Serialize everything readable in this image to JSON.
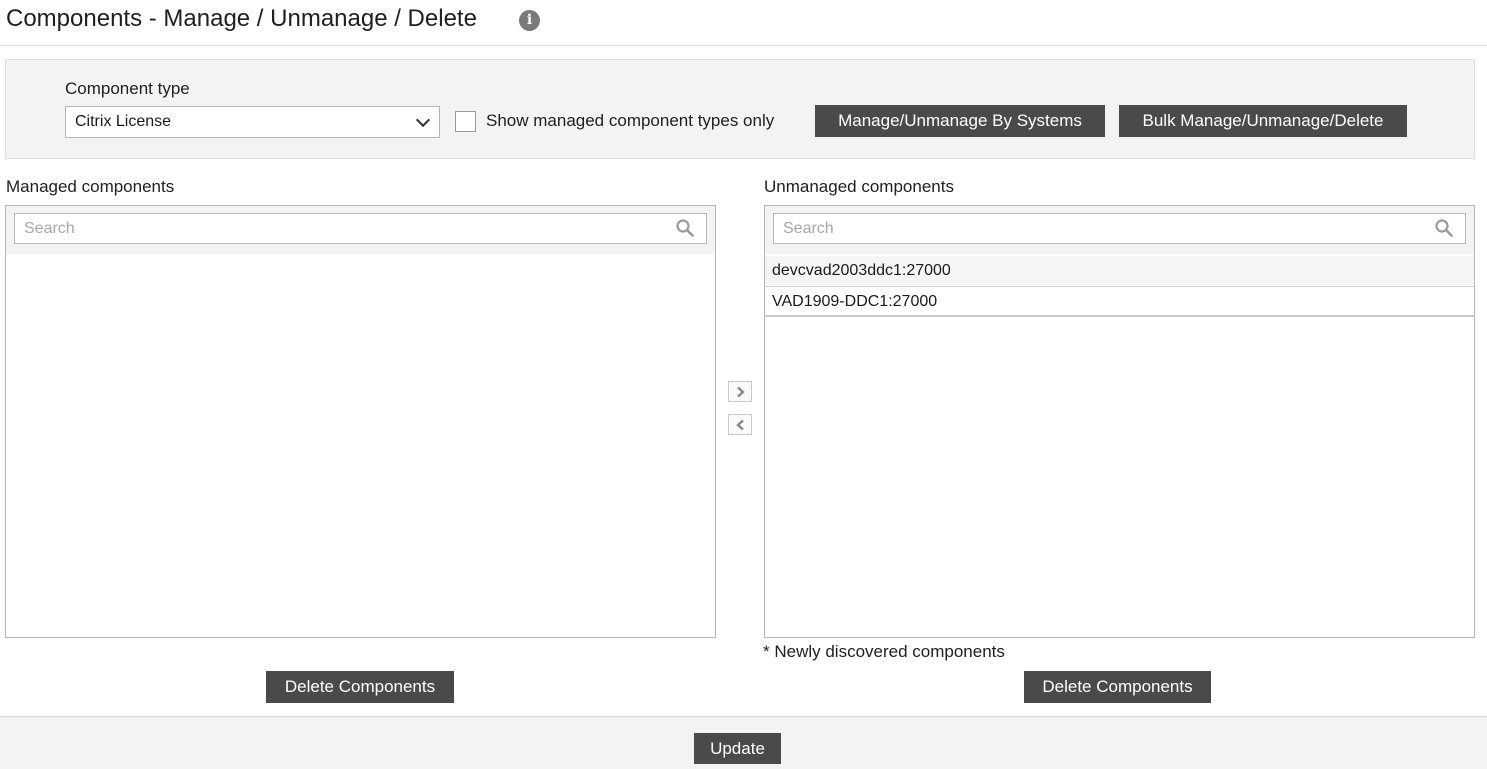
{
  "page": {
    "title": "Components - Manage / Unmanage / Delete",
    "info_icon": "info-icon"
  },
  "filter": {
    "component_type_label": "Component type",
    "component_type_value": "Citrix License",
    "show_managed_only_label": "Show managed component types only",
    "show_managed_only_checked": false,
    "manage_by_systems_label": "Manage/Unmanage By Systems",
    "bulk_label": "Bulk Manage/Unmanage/Delete"
  },
  "managed": {
    "label": "Managed components",
    "search_placeholder": "Search",
    "items": [],
    "delete_label": "Delete Components"
  },
  "unmanaged": {
    "label": "Unmanaged components",
    "search_placeholder": "Search",
    "items": [
      "devcvad2003ddc1:27000",
      "VAD1909-DDC1:27000"
    ],
    "note": "* Newly discovered components",
    "delete_label": "Delete Components"
  },
  "move": {
    "right_icon": "chevron-right-icon",
    "left_icon": "chevron-left-icon"
  },
  "footer": {
    "update_label": "Update"
  },
  "colors": {
    "button_bg": "#4a4a4a",
    "panel_bg": "#f3f3f3",
    "border": "#b5b5b5"
  }
}
